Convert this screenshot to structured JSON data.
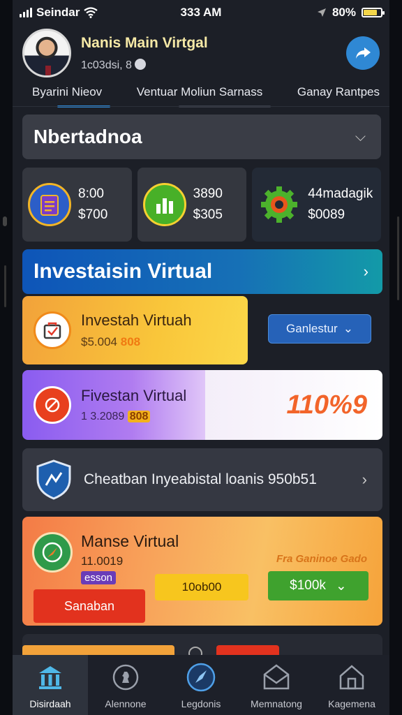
{
  "status": {
    "carrier": "Seindar",
    "time": "333 AM",
    "battery": "80%",
    "battery_level": 0.8
  },
  "profile": {
    "name": "Nanis Main Virtgal",
    "subtitle": "1c03dsi, 8"
  },
  "tabs": [
    {
      "label": "Byarini Nieov",
      "active": true
    },
    {
      "label": "Ventuar Moliun Sarnass",
      "active": false
    },
    {
      "label": "Ganay Rantpes",
      "active": false
    }
  ],
  "dropdown": {
    "label": "Nbertadnoa"
  },
  "stats": [
    {
      "value1": "8:00",
      "value2": "$700",
      "icon": "clipboard-icon"
    },
    {
      "value1": "3890",
      "value2": "$305",
      "icon": "bar-chart-icon"
    },
    {
      "value1": "44madagik",
      "value2": "$0089",
      "icon": "gear-icon"
    }
  ],
  "banner": {
    "title": "Investaisin Virtual"
  },
  "card1": {
    "title": "Investah Virtuah",
    "value": "$5.004",
    "highlight": "808",
    "button": "Ganlestur"
  },
  "card2": {
    "title": "Fivestan Virtual",
    "value": "1 3.2089",
    "highlight": "808",
    "percent": "110%9"
  },
  "shield_row": {
    "text": "Cheatban Inyeabistal loanis 950b51"
  },
  "card4": {
    "title": "Manse Virtual",
    "value": "11.0019",
    "badge": "esson",
    "promo": "Fra Ganinoe Gado",
    "red_button": "Sanaban",
    "yellow_button": "10ob00",
    "green_button": "$100k"
  },
  "bottom_nav": [
    {
      "label": "Disirdaah",
      "icon": "bank-icon",
      "active": true
    },
    {
      "label": "Alennone",
      "icon": "chess-icon",
      "active": false
    },
    {
      "label": "Legdonis",
      "icon": "rocket-icon",
      "active": false
    },
    {
      "label": "Memnatong",
      "icon": "mail-icon",
      "active": false
    },
    {
      "label": "Kagemena",
      "icon": "home-icon",
      "active": false
    }
  ],
  "colors": {
    "background": "#1c1f27",
    "accent": "#2f88d4",
    "tab_underline": "#2f88d4"
  }
}
